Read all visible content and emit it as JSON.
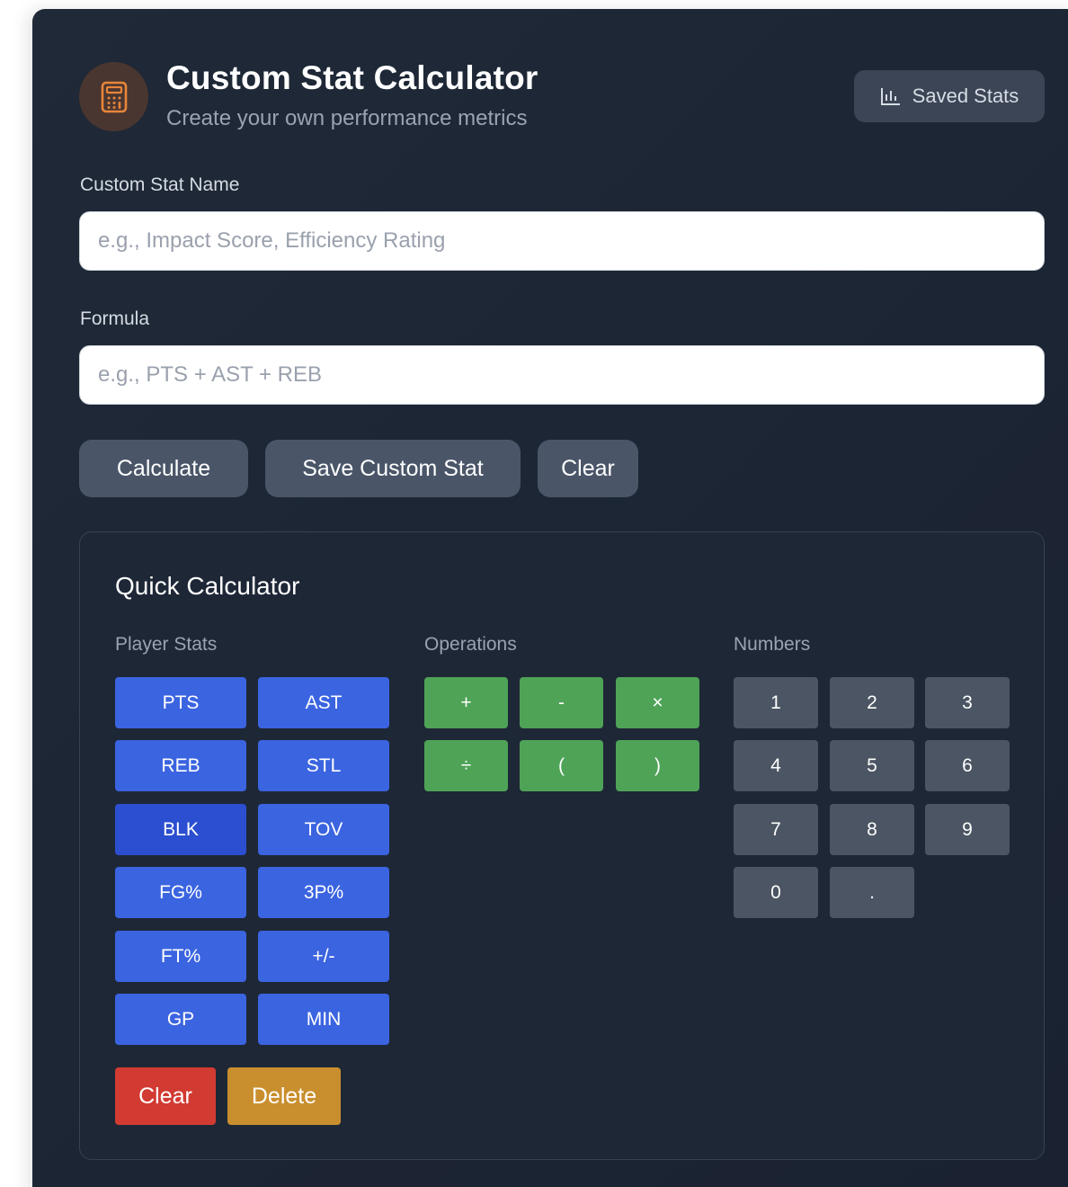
{
  "header": {
    "title": "Custom Stat Calculator",
    "subtitle": "Create your own performance metrics",
    "logo_icon": "calculator-icon",
    "saved_stats_label": "Saved Stats",
    "saved_stats_icon": "bar-chart-icon"
  },
  "form": {
    "name_label": "Custom Stat Name",
    "name_placeholder": "e.g., Impact Score, Efficiency Rating",
    "name_value": "",
    "formula_label": "Formula",
    "formula_placeholder": "e.g., PTS + AST + REB",
    "formula_value": ""
  },
  "actions": {
    "calculate": "Calculate",
    "save": "Save Custom Stat",
    "clear": "Clear"
  },
  "quick_calculator": {
    "title": "Quick Calculator",
    "player_stats_label": "Player Stats",
    "operations_label": "Operations",
    "numbers_label": "Numbers",
    "stats": [
      "PTS",
      "AST",
      "REB",
      "STL",
      "BLK",
      "TOV",
      "FG%",
      "3P%",
      "FT%",
      "+/-",
      "GP",
      "MIN"
    ],
    "operations": [
      "+",
      "-",
      "×",
      "÷",
      "(",
      ")"
    ],
    "numbers": [
      "1",
      "2",
      "3",
      "4",
      "5",
      "6",
      "7",
      "8",
      "9",
      "0",
      "."
    ],
    "clear_label": "Clear",
    "delete_label": "Delete"
  },
  "colors": {
    "stat_button": "#3b64e0",
    "operation_button": "#4ea357",
    "number_button": "#4b5563",
    "clear_button": "#d13b32",
    "delete_button": "#c98f2e",
    "logo_accent": "#e8853a"
  }
}
